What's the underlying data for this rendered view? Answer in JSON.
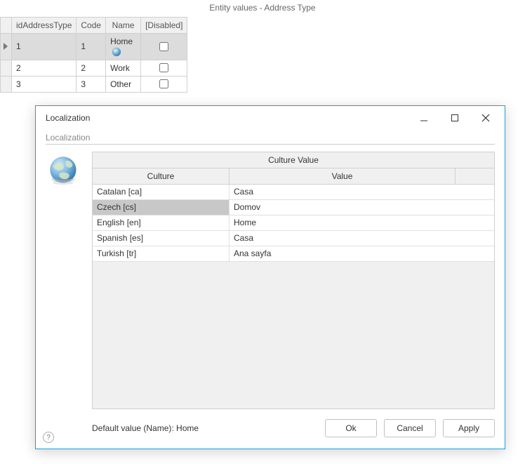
{
  "parent": {
    "title": "Entity values - Address Type"
  },
  "grid": {
    "headers": {
      "id": "idAddressType",
      "code": "Code",
      "name": "Name",
      "disabled": "[Disabled]"
    },
    "rows": [
      {
        "id": "1",
        "code": "1",
        "name": "Home",
        "disabled": false,
        "selected": true
      },
      {
        "id": "2",
        "code": "2",
        "name": "Work",
        "disabled": false,
        "selected": false
      },
      {
        "id": "3",
        "code": "3",
        "name": "Other",
        "disabled": false,
        "selected": false
      }
    ]
  },
  "dialog": {
    "title": "Localization",
    "section_label": "Localization",
    "table": {
      "title": "Culture Value",
      "col_culture": "Culture",
      "col_value": "Value",
      "rows": [
        {
          "culture": "Catalan [ca]",
          "value": "Casa",
          "selected": false
        },
        {
          "culture": "Czech [cs]",
          "value": "Domov",
          "selected": true
        },
        {
          "culture": "English [en]",
          "value": "Home",
          "selected": false
        },
        {
          "culture": "Spanish [es]",
          "value": "Casa",
          "selected": false
        },
        {
          "culture": "Turkish [tr]",
          "value": "Ana sayfa",
          "selected": false
        }
      ]
    },
    "default_label": "Default value (Name): Home",
    "buttons": {
      "ok": "Ok",
      "cancel": "Cancel",
      "apply": "Apply"
    }
  }
}
